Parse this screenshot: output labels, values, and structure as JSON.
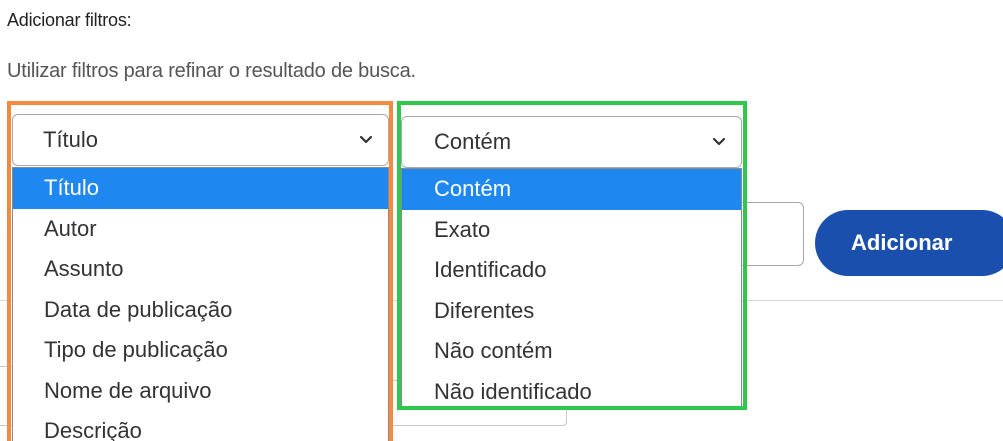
{
  "filters": {
    "heading": "Adicionar filtros:",
    "hint": "Utilizar filtros para refinar o resultado de busca."
  },
  "field_select": {
    "selected": "Título",
    "options": [
      {
        "label": "Título",
        "selected": true
      },
      {
        "label": "Autor",
        "selected": false
      },
      {
        "label": "Assunto",
        "selected": false
      },
      {
        "label": "Data de publicação",
        "selected": false
      },
      {
        "label": "Tipo de publicação",
        "selected": false
      },
      {
        "label": "Nome de arquivo",
        "selected": false
      },
      {
        "label": "Descrição",
        "selected": false
      }
    ]
  },
  "condition_select": {
    "selected": "Contém",
    "options": [
      {
        "label": "Contém",
        "selected": true
      },
      {
        "label": "Exato",
        "selected": false
      },
      {
        "label": "Identificado",
        "selected": false
      },
      {
        "label": "Diferentes",
        "selected": false
      },
      {
        "label": "Não contém",
        "selected": false
      },
      {
        "label": "Não identificado",
        "selected": false
      }
    ]
  },
  "add_button": {
    "label": "Adicionar"
  },
  "colors": {
    "highlight_field": "#f58a3c",
    "highlight_condition": "#2dc84d",
    "selected_option": "#1e87f0",
    "button": "#1a4fae"
  },
  "icons": {
    "select_arrow": "chevron-down-icon"
  }
}
